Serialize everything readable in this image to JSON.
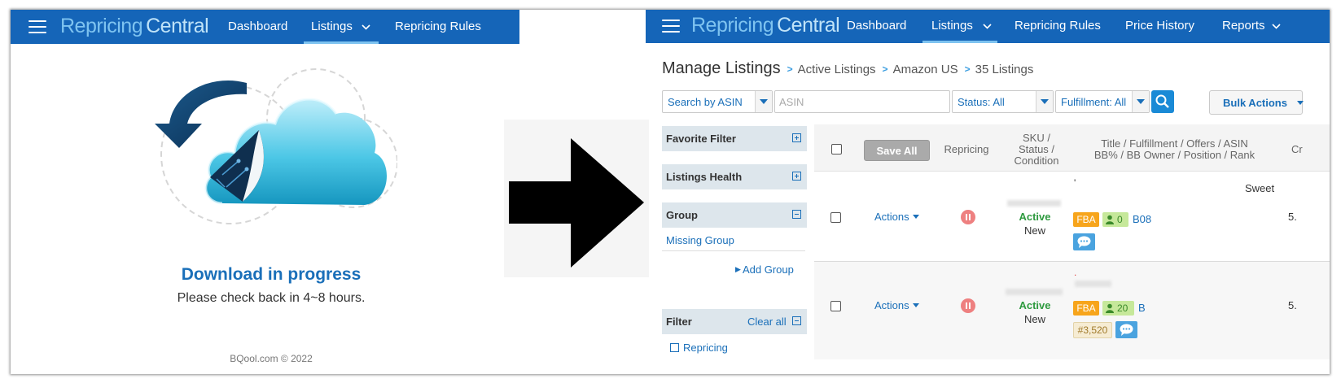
{
  "left_panel": {
    "nav": {
      "logo_a": "Repricing",
      "logo_b": "Central",
      "links": [
        "Dashboard",
        "Listings",
        "Repricing Rules"
      ]
    },
    "title": "Download in progress",
    "subtitle": "Please check back in 4~8 hours.",
    "footer": "BQool.com © 2022"
  },
  "right_panel": {
    "nav": {
      "logo_a": "Repricing",
      "logo_b": "Central",
      "links": [
        "Dashboard",
        "Listings",
        "Repricing Rules",
        "Price History",
        "Reports"
      ]
    },
    "breadcrumb": {
      "title": "Manage Listings",
      "items": [
        "Active Listings",
        "Amazon US",
        "35 Listings"
      ]
    },
    "controls": {
      "search_by": "Search by ASIN",
      "search_placeholder": "ASIN",
      "status": "Status: All",
      "fulfillment": "Fulfillment: All",
      "bulk_actions": "Bulk Actions"
    },
    "sidebar": {
      "favorite_filter": "Favorite Filter",
      "listings_health": "Listings Health",
      "group": "Group",
      "missing_group": "Missing Group",
      "add_group": "Add Group",
      "filter": "Filter",
      "clear_all": "Clear all",
      "repricing": "Repricing"
    },
    "table": {
      "save_all": "Save All",
      "headers": {
        "repricing": "Repricing",
        "sku_1": "SKU /",
        "sku_2": "Status /",
        "sku_3": "Condition",
        "title_1": "Title / Fulfillment / Offers / ASIN",
        "title_2": "BB% / BB Owner / Position / Rank",
        "cut": "Cr"
      },
      "rows": [
        {
          "actions": "Actions",
          "status": "Active",
          "condition": "New",
          "title_mark": "'",
          "title_snippet": "Sweet",
          "fulfillment": "FBA",
          "offers": "0",
          "asin": "B08",
          "rank": "",
          "cut": "5."
        },
        {
          "actions": "Actions",
          "status": "Active",
          "condition": "New",
          "title_mark": ".",
          "title_snippet": "",
          "fulfillment": "FBA",
          "offers": "20",
          "asin": "B",
          "rank": "#3,520",
          "cut": "5."
        }
      ]
    }
  },
  "colors": {
    "nav_bg": "#1565b8",
    "logo_light": "#7ec3f0",
    "link_blue": "#1a6fb9",
    "active_green": "#2e9a3f",
    "fba_orange": "#f7a51c"
  }
}
